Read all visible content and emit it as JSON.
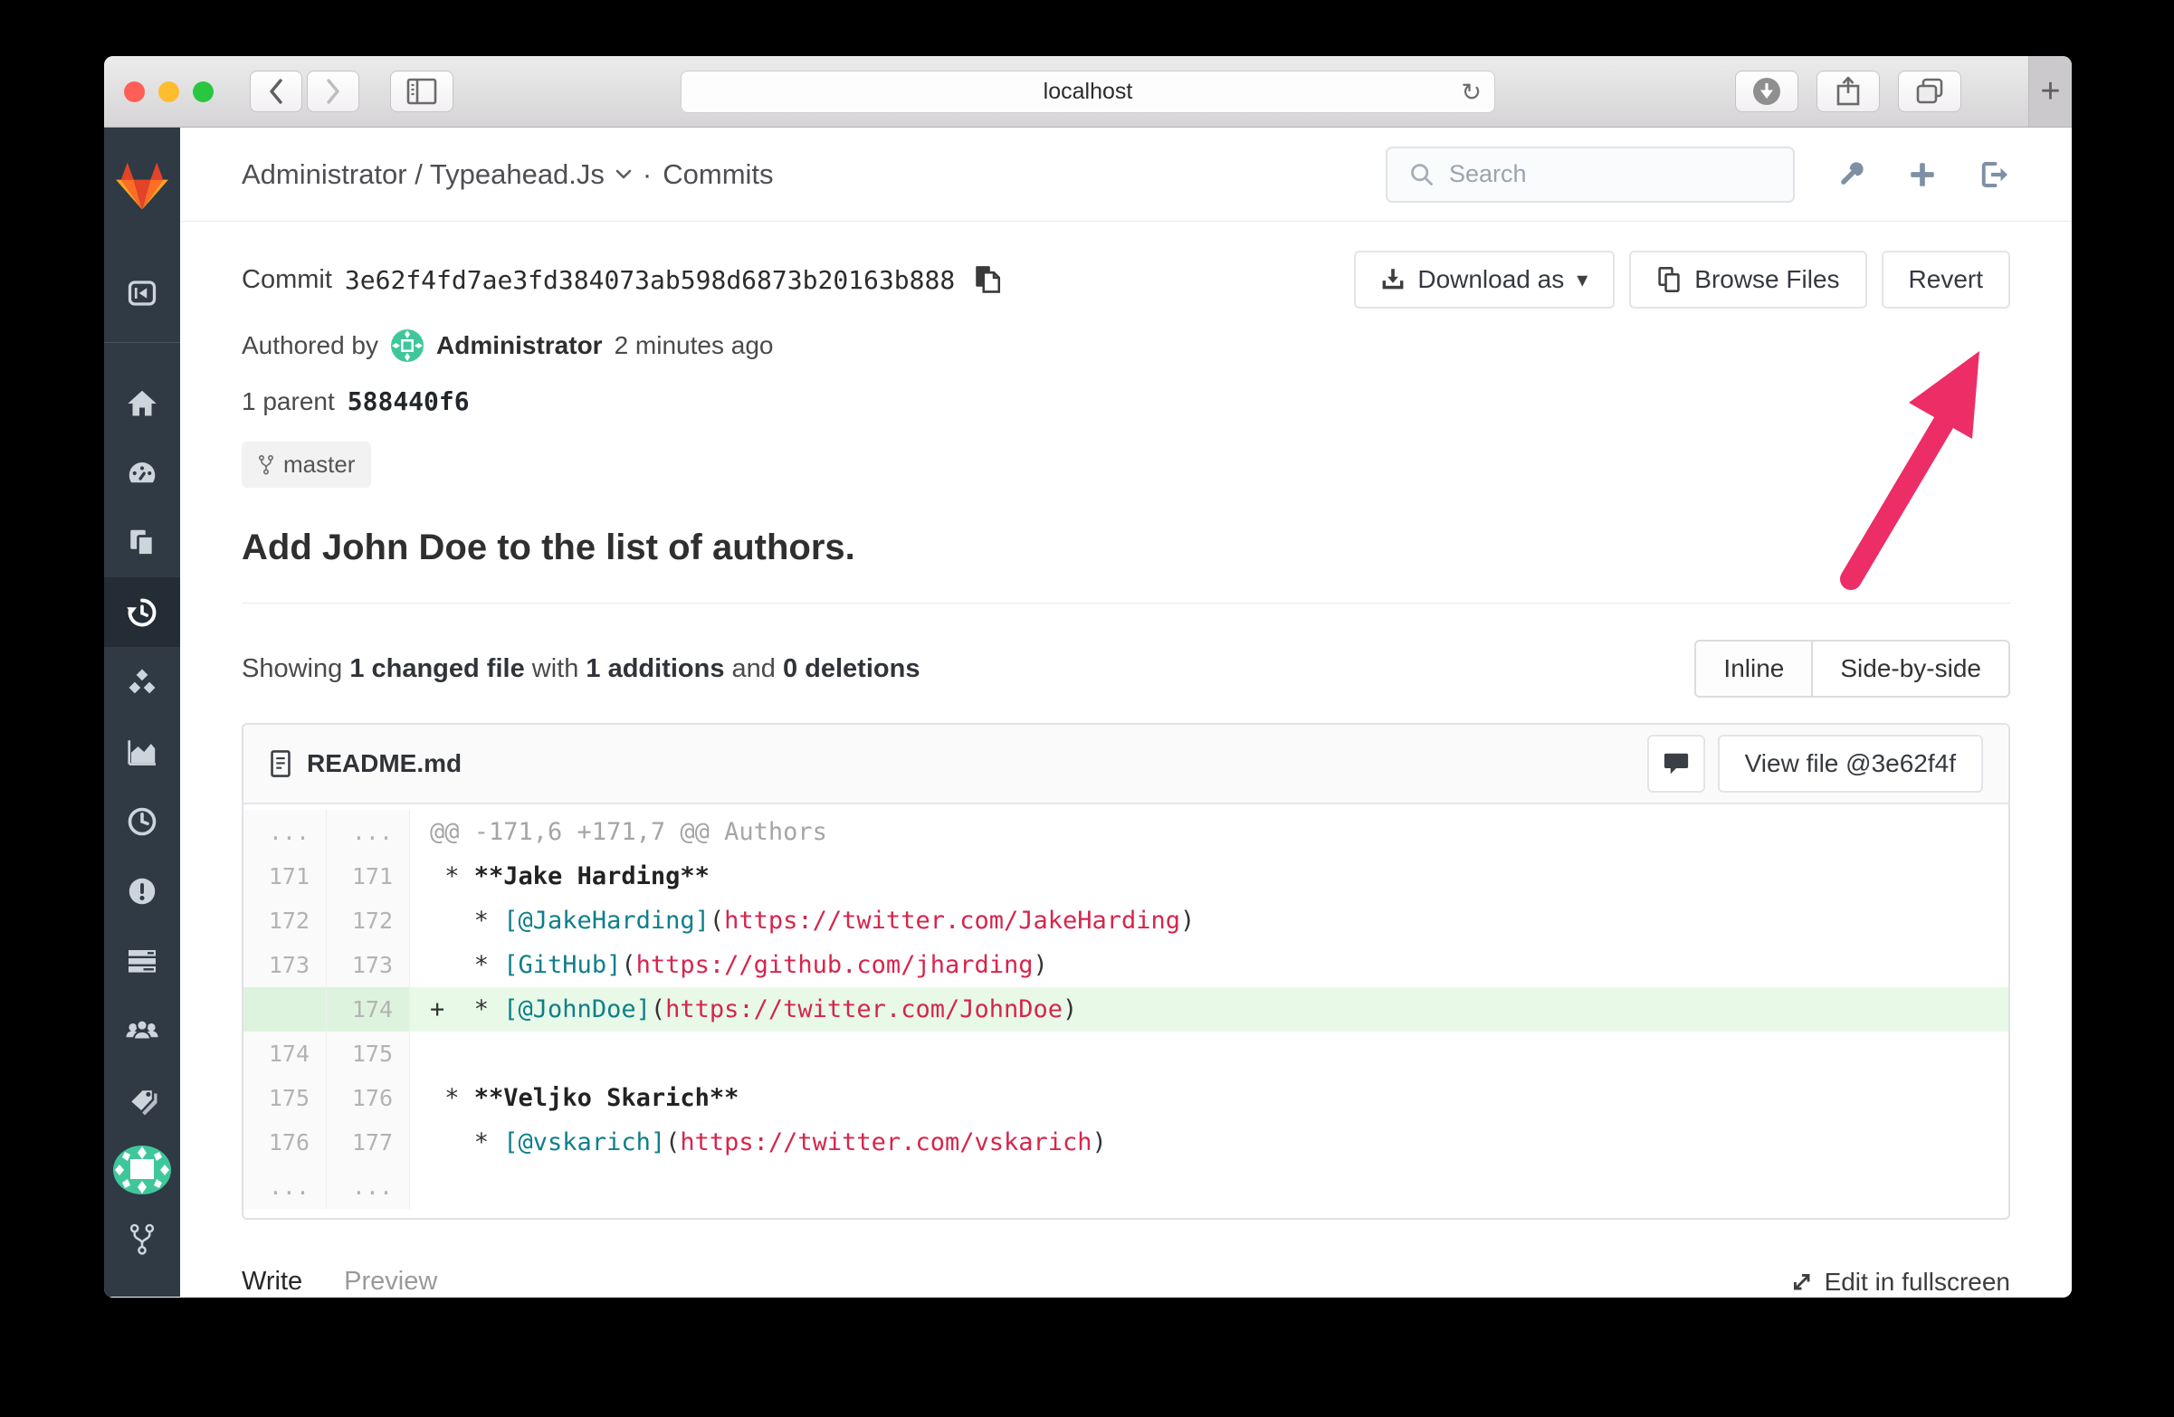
{
  "browser": {
    "url": "localhost",
    "reload_glyph": "↻",
    "new_tab_glyph": "+",
    "icons": [
      "back-icon",
      "forward-icon",
      "sidebar-toggle-icon",
      "downloads-icon",
      "share-icon",
      "tab-overview-icon"
    ]
  },
  "header": {
    "repo": "Administrator / Typeahead.Js",
    "separator": "·",
    "page": "Commits",
    "search_placeholder": "Search",
    "icons": [
      "wrench-icon",
      "plus-icon",
      "sign-out-icon"
    ]
  },
  "sidebar": {
    "icons": [
      "collapse",
      "home",
      "dashboard",
      "files",
      "history",
      "cubes",
      "charts",
      "clock",
      "issues",
      "merge-requests",
      "members",
      "tags",
      "profile-avatar",
      "fork"
    ],
    "active": "history"
  },
  "commit": {
    "label": "Commit",
    "hash": "3e62f4fd7ae3fd384073ab598d6873b20163b888",
    "authored_prefix": "Authored by",
    "author": "Administrator",
    "authored_time": "2 minutes ago",
    "parent_label": "1 parent",
    "parent_hash": "588440f6",
    "branch": "master",
    "title": "Add John Doe to the list of authors.",
    "buttons": {
      "download": "Download as",
      "download_caret": "▾",
      "browse": "Browse Files",
      "revert": "Revert"
    }
  },
  "summary": {
    "prefix": "Showing ",
    "changed": "1 changed file",
    "middle": " with ",
    "additions": "1 additions",
    "and": " and ",
    "deletions": "0 deletions",
    "view_toggle": [
      "Inline",
      "Side-by-side"
    ]
  },
  "diff": {
    "file": "README.md",
    "view_file": "View file @3e62f4f",
    "lines": [
      {
        "old": "...",
        "new": "...",
        "type": "hunk",
        "parts": [
          {
            "t": "@@ -171,6 +171,7 @@ Authors",
            "c": "hk"
          }
        ]
      },
      {
        "old": "171",
        "new": "171",
        "type": "ctx",
        "parts": [
          {
            "t": " * ",
            "c": "pl"
          },
          {
            "t": "**Jake Harding**",
            "c": "bd"
          }
        ]
      },
      {
        "old": "172",
        "new": "172",
        "type": "ctx",
        "parts": [
          {
            "t": "   * ",
            "c": "pl"
          },
          {
            "t": "[@JakeHarding]",
            "c": "lk"
          },
          {
            "t": "(",
            "c": "pl"
          },
          {
            "t": "https://twitter.com/JakeHarding",
            "c": "ur"
          },
          {
            "t": ")",
            "c": "pl"
          }
        ]
      },
      {
        "old": "173",
        "new": "173",
        "type": "ctx",
        "parts": [
          {
            "t": "   * ",
            "c": "pl"
          },
          {
            "t": "[GitHub]",
            "c": "lk"
          },
          {
            "t": "(",
            "c": "pl"
          },
          {
            "t": "https://github.com/jharding",
            "c": "ur"
          },
          {
            "t": ")",
            "c": "pl"
          }
        ]
      },
      {
        "old": "",
        "new": "174",
        "type": "add",
        "parts": [
          {
            "t": "+  * ",
            "c": "pl"
          },
          {
            "t": "[@JohnDoe]",
            "c": "lk"
          },
          {
            "t": "(",
            "c": "pl"
          },
          {
            "t": "https://twitter.com/JohnDoe",
            "c": "ur"
          },
          {
            "t": ")",
            "c": "pl"
          }
        ]
      },
      {
        "old": "174",
        "new": "175",
        "type": "ctx",
        "parts": []
      },
      {
        "old": "175",
        "new": "176",
        "type": "ctx",
        "parts": [
          {
            "t": " * ",
            "c": "pl"
          },
          {
            "t": "**Veljko Skarich**",
            "c": "bd"
          }
        ]
      },
      {
        "old": "176",
        "new": "177",
        "type": "ctx",
        "parts": [
          {
            "t": "   * ",
            "c": "pl"
          },
          {
            "t": "[@vskarich]",
            "c": "lk"
          },
          {
            "t": "(",
            "c": "pl"
          },
          {
            "t": "https://twitter.com/vskarich",
            "c": "ur"
          },
          {
            "t": ")",
            "c": "pl"
          }
        ]
      },
      {
        "old": "...",
        "new": "...",
        "type": "end",
        "parts": []
      }
    ]
  },
  "editor": {
    "tabs": [
      "Write",
      "Preview"
    ],
    "fullscreen": "Edit in fullscreen"
  },
  "colors": {
    "sidebar_bg": "#2f3a45",
    "sidebar_active_bg": "#242c35",
    "addition_text": "#46a135",
    "deletion_text": "#cc2f2e",
    "added_line_bg": "#e8f9e8",
    "link_syntax": "#0e7f8a",
    "url_syntax": "#d6254c",
    "arrow_pink": "#ed2d66",
    "tab_active_underline": "#4a90d2",
    "gitlab_logo": [
      "#e24329",
      "#fc6d26",
      "#fca326"
    ],
    "avatar_green": "#3fc79b",
    "traffic_lights": [
      "#ff5f57",
      "#febc2f",
      "#29c73f"
    ]
  }
}
